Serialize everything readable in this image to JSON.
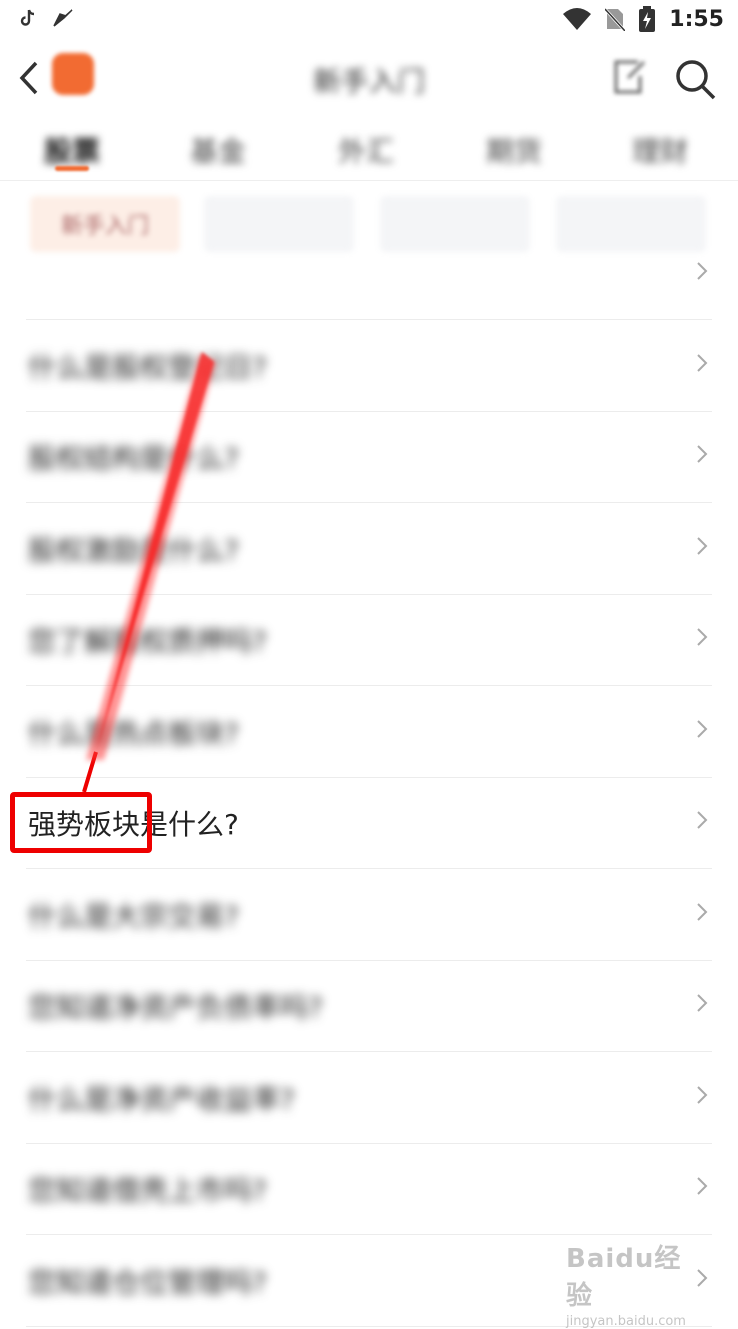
{
  "status_bar": {
    "time": "1:55",
    "icons": [
      "tiktok-icon",
      "send-icon",
      "wifi-icon",
      "no-sim-icon",
      "battery-charging-icon"
    ]
  },
  "header": {
    "title": "新手入门",
    "icons": [
      "back-icon",
      "app-logo",
      "share-icon",
      "search-icon"
    ]
  },
  "tabs": [
    "股票",
    "基金",
    "外汇",
    "期货",
    "理财"
  ],
  "chips": [
    "新手入门",
    "",
    "",
    ""
  ],
  "list": {
    "items": [
      {
        "text": "",
        "blurred": true
      },
      {
        "text": "什么是股权登记日?",
        "blurred": true
      },
      {
        "text": "股权结构是什么?",
        "blurred": true
      },
      {
        "text": "股权激励是什么?",
        "blurred": true
      },
      {
        "text": "您了解股权质押吗?",
        "blurred": true
      },
      {
        "text": "什么是热点板块?",
        "blurred": true
      },
      {
        "text": "强势板块是什么?",
        "blurred": false
      },
      {
        "text": "什么是大宗交易?",
        "blurred": true
      },
      {
        "text": "您知道净资产负债率吗?",
        "blurred": true
      },
      {
        "text": "什么是净资产收益率?",
        "blurred": true
      },
      {
        "text": "您知道借壳上市吗?",
        "blurred": true
      },
      {
        "text": "您知道仓位管理吗?",
        "blurred": true
      }
    ]
  },
  "annotation": {
    "highlight_text": "强势板块",
    "color": "#ee0000"
  },
  "watermark": {
    "brand": "Baidu经验",
    "url": "jingyan.baidu.com"
  },
  "colors": {
    "accent": "#f26b32",
    "divider": "#ececec",
    "chip_bg": "#f4f5f7"
  }
}
